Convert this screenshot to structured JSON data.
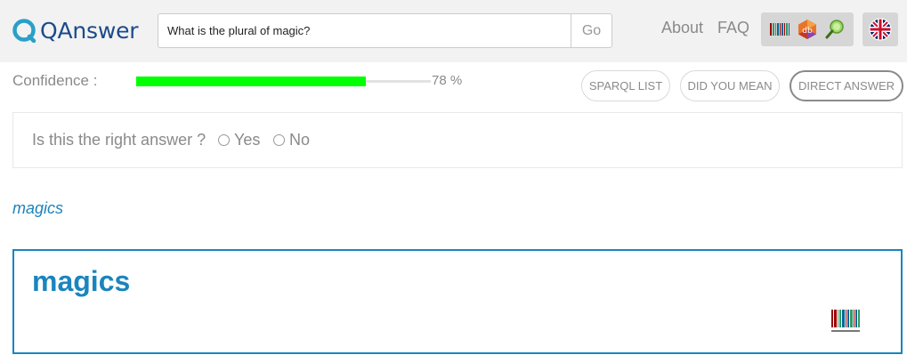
{
  "header": {
    "logo_text": "QAnswer",
    "search": {
      "value": "What is the plural of magic?",
      "placeholder": ""
    },
    "go_label": "Go",
    "nav": {
      "about": "About",
      "faq": "FAQ"
    },
    "knowledge_base_icons": [
      "wikidata-icon",
      "dbpedia-icon",
      "search-kb-icon"
    ],
    "language_icon": "uk-flag-icon"
  },
  "confidence": {
    "label": "Confidence :",
    "value_text": "78 %",
    "value": 78,
    "bar_color": "#00ff00"
  },
  "tabs": {
    "sparql": "SPARQL LIST",
    "did_you_mean": "DID YOU MEAN",
    "direct": "DIRECT ANSWER"
  },
  "feedback": {
    "question": "Is this the right answer ?",
    "yes": "Yes",
    "no": "No"
  },
  "answer": {
    "link": "magics",
    "title": "magics",
    "source_icon": "wikidata-logo"
  },
  "colors": {
    "accent": "#1a85bd",
    "topbar": "#f2f2f2",
    "muted_text": "#8a8a8a"
  }
}
